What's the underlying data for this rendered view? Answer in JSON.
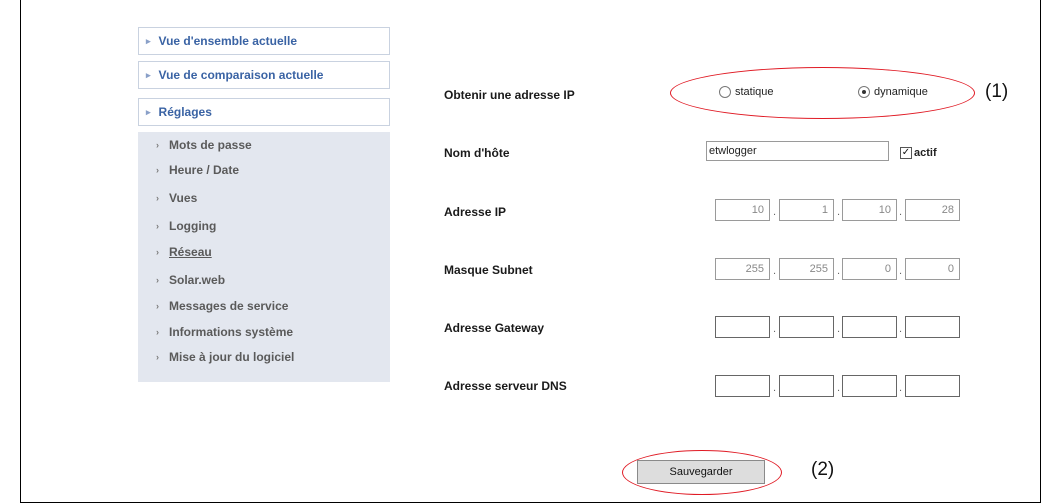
{
  "nav": {
    "top_items": [
      {
        "label": "Vue d'ensemble actuelle"
      },
      {
        "label": "Vue de comparaison actuelle"
      },
      {
        "label": "Réglages"
      }
    ],
    "sub_items": [
      {
        "label": "Mots de passe"
      },
      {
        "label": "Heure / Date"
      },
      {
        "label": "Vues"
      },
      {
        "label": "Logging"
      },
      {
        "label": "Réseau",
        "active": true
      },
      {
        "label": "Solar.web"
      },
      {
        "label": "Messages de service"
      },
      {
        "label": "Informations système"
      },
      {
        "label": "Mise à jour du logiciel"
      }
    ]
  },
  "form": {
    "ip_mode": {
      "label": "Obtenir une adresse IP",
      "options": [
        "statique",
        "dynamique"
      ],
      "selected": "dynamique"
    },
    "hostname": {
      "label": "Nom d'hôte",
      "value": "etwlogger",
      "checkbox_label": "actif",
      "checkbox_checked": true
    },
    "ip_address": {
      "label": "Adresse IP",
      "octets": [
        "10",
        "1",
        "10",
        "28"
      ]
    },
    "subnet_mask": {
      "label": "Masque Subnet",
      "octets": [
        "255",
        "255",
        "0",
        "0"
      ]
    },
    "gateway": {
      "label": "Adresse Gateway",
      "octets": [
        "",
        "",
        "",
        ""
      ]
    },
    "dns": {
      "label": "Adresse serveur DNS",
      "octets": [
        "",
        "",
        "",
        ""
      ]
    },
    "save_label": "Sauvegarder"
  },
  "callouts": {
    "one": "(1)",
    "two": "(2)"
  },
  "colors": {
    "nav_text": "#3a63a4",
    "sub_bg": "#e3e7ef",
    "highlight": "#e01a24"
  }
}
